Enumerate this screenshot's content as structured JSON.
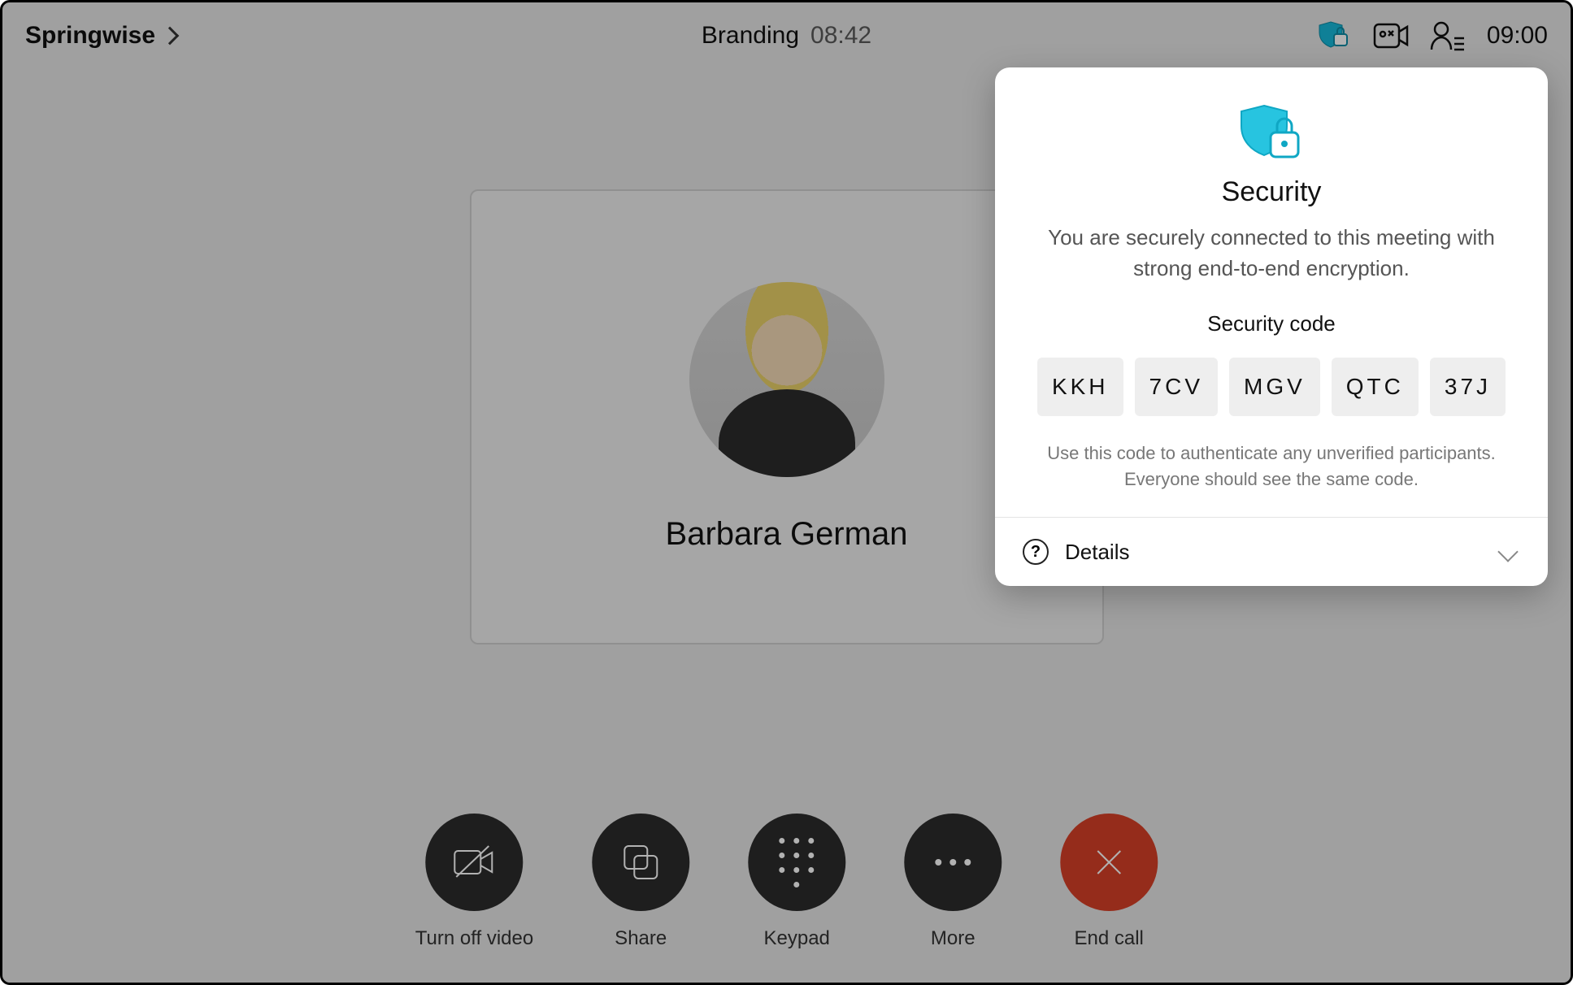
{
  "header": {
    "org_name": "Springwise",
    "meeting_title": "Branding",
    "elapsed": "08:42",
    "clock": "09:00"
  },
  "participant": {
    "name": "Barbara German"
  },
  "controls": {
    "video": "Turn off video",
    "share": "Share",
    "keypad": "Keypad",
    "more": "More",
    "end": "End call"
  },
  "security_popover": {
    "title": "Security",
    "description": "You are securely connected to this meeting with strong end-to-end encryption.",
    "code_label": "Security code",
    "code": [
      "KKH",
      "7CV",
      "MGV",
      "QTC",
      "37J"
    ],
    "hint": "Use this code to authenticate any unverified participants. Everyone should see the same code.",
    "details_label": "Details"
  },
  "colors": {
    "accent": "#16b8d8",
    "danger": "#d64027"
  }
}
